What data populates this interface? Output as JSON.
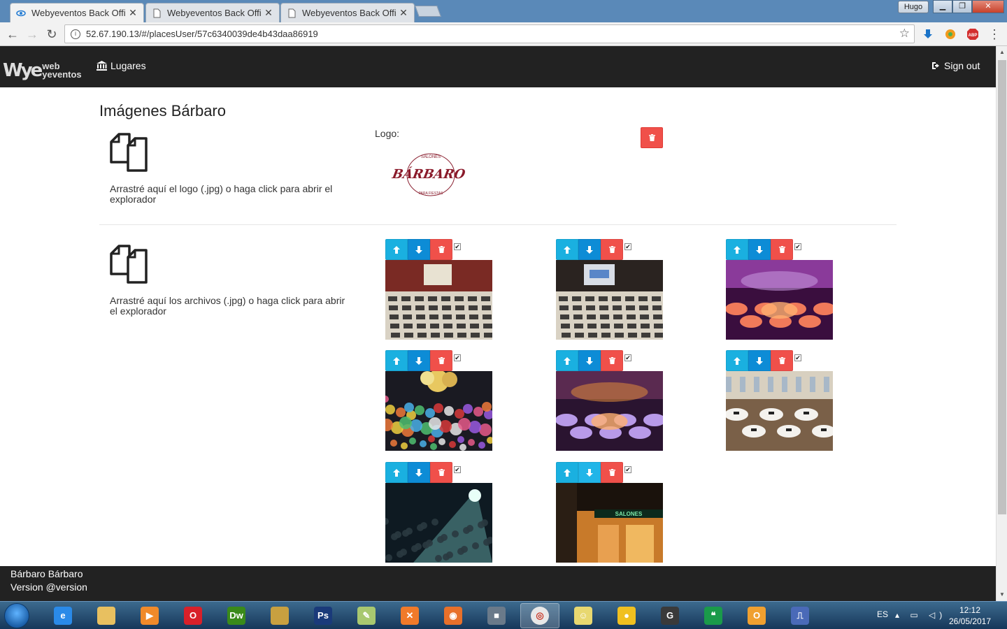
{
  "browser": {
    "tabs": [
      {
        "title": "Webyeventos Back Office",
        "active": true
      },
      {
        "title": "Webyeventos Back Office",
        "active": false
      },
      {
        "title": "Webyeventos Back Office",
        "active": false
      }
    ],
    "user_badge": "Hugo",
    "address": "52.67.190.13/#/placesUser/57c6340039de4b43daa86919",
    "extensions": [
      "download-icon",
      "extension-icon",
      "adblock-icon",
      "menu-icon"
    ]
  },
  "navbar": {
    "brand_mark": "ye",
    "brand_line1": "web",
    "brand_line2": "yeventos",
    "lugares_label": "Lugares",
    "signout_label": "Sign out"
  },
  "page": {
    "title": "Imágenes Bárbaro",
    "logo_dropzone_text": "Arrastré aquí el logo (.jpg) o haga click para abrir el explorador",
    "logo_label": "Logo:",
    "logo_alt_top": "SALONES",
    "logo_alt_main": "BÁRBARO",
    "logo_alt_bottom": "PARA FIESTAS",
    "files_dropzone_text": "Arrastré aquí los archivos (.jpg) o haga click para abrir el explorador"
  },
  "gallery": [
    {
      "scene": "conference-room",
      "checked": true
    },
    {
      "scene": "conference-room-screen",
      "checked": true
    },
    {
      "scene": "banquet-purple",
      "checked": true
    },
    {
      "scene": "party-crowd",
      "checked": true
    },
    {
      "scene": "banquet-violet",
      "checked": true
    },
    {
      "scene": "banquet-white",
      "checked": true
    },
    {
      "scene": "dance-floor",
      "checked": true
    },
    {
      "scene": "storefront-night",
      "checked": true,
      "down_active": true
    }
  ],
  "footer": {
    "line1": "Bárbaro Bárbaro",
    "line2": "Version @version"
  },
  "taskbar": {
    "apps": [
      "ie",
      "explorer",
      "media",
      "opera",
      "dreamweaver",
      "files",
      "photoshop",
      "notepad",
      "xampp",
      "firefox",
      "security",
      "chrome",
      "notes",
      "norton",
      "g-app",
      "hangouts",
      "outlook",
      "network"
    ],
    "lang": "ES",
    "time": "12:12",
    "date": "26/05/2017"
  },
  "colors": {
    "navbar": "#222222",
    "btn_info": "#1ab0e0",
    "btn_primary": "#0d8cd6",
    "btn_danger": "#f0504a"
  }
}
